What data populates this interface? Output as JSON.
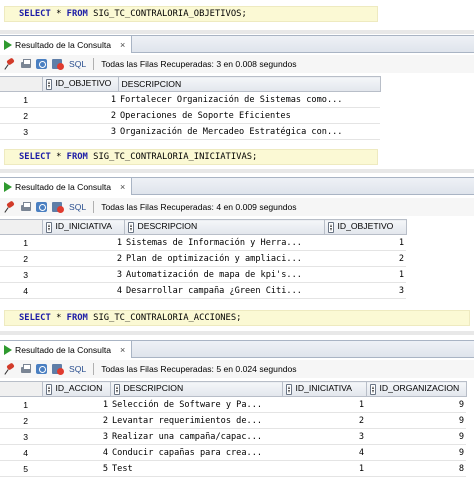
{
  "results_tab_label": "Resultado de la Consulta",
  "toolbar": {
    "sql_label": "SQL"
  },
  "queries": [
    {
      "sql": {
        "keyword1": "SELECT",
        "rest1": " * ",
        "keyword2": "FROM",
        "table": " SIG_TC_CONTRALORIA_OBJETIVOS;"
      },
      "status": "Todas las Filas Recuperadas: 3 en 0.008 segundos",
      "columns": [
        "ID_OBJETIVO",
        "DESCRIPCION"
      ],
      "rows": [
        {
          "n": "1",
          "c": [
            "1",
            "Fortalecer Organización de Sistemas como..."
          ]
        },
        {
          "n": "2",
          "c": [
            "2",
            "Operaciones de Soporte Eficientes"
          ]
        },
        {
          "n": "3",
          "c": [
            "3",
            "Organización de Mercadeo Estratégica con..."
          ]
        }
      ]
    },
    {
      "sql": {
        "keyword1": "SELECT",
        "rest1": " * ",
        "keyword2": "FROM",
        "table": " SIG_TC_CONTRALORIA_INICIATIVAS;"
      },
      "status": "Todas las Filas Recuperadas: 4 en 0.009 segundos",
      "columns": [
        "ID_INICIATIVA",
        "DESCRIPCION",
        "ID_OBJETIVO"
      ],
      "rows": [
        {
          "n": "1",
          "c": [
            "1",
            "Sistemas de Información y Herra...",
            "1"
          ]
        },
        {
          "n": "2",
          "c": [
            "2",
            "Plan de optimización y ampliaci...",
            "2"
          ]
        },
        {
          "n": "3",
          "c": [
            "3",
            "Automatización de mapa de kpi's...",
            "1"
          ]
        },
        {
          "n": "4",
          "c": [
            "4",
            "Desarrollar campaña ¿Green Citi...",
            "3"
          ]
        }
      ]
    },
    {
      "sql": {
        "keyword1": "SELECT",
        "rest1": " * ",
        "keyword2": "FROM",
        "table": " SIG_TC_CONTRALORIA_ACCIONES;"
      },
      "status": "Todas las Filas Recuperadas: 5 en 0.024 segundos",
      "columns": [
        "ID_ACCION",
        "DESCRIPCION",
        "ID_INICIATIVA",
        "ID_ORGANIZACION"
      ],
      "rows": [
        {
          "n": "1",
          "c": [
            "1",
            "Selección de Software y Pa...",
            "1",
            "9"
          ]
        },
        {
          "n": "2",
          "c": [
            "2",
            "Levantar requerimientos de...",
            "2",
            "9"
          ]
        },
        {
          "n": "3",
          "c": [
            "3",
            "Realizar una campaña/capac...",
            "3",
            "9"
          ]
        },
        {
          "n": "4",
          "c": [
            "4",
            "Conducir capañas para crea...",
            "4",
            "9"
          ]
        },
        {
          "n": "5",
          "c": [
            "5",
            "Test",
            "1",
            "8"
          ]
        }
      ]
    }
  ]
}
